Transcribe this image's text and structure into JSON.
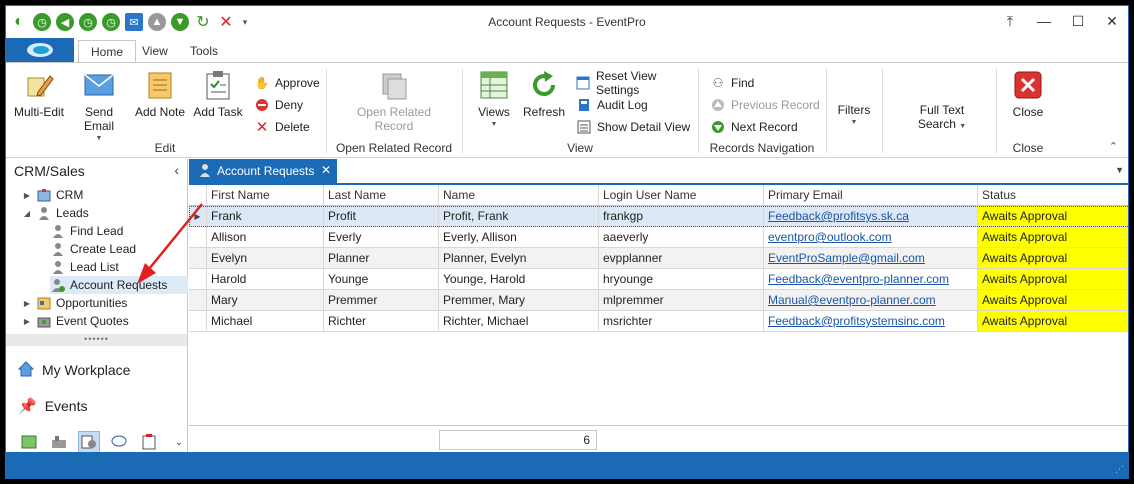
{
  "window": {
    "title": "Account Requests - EventPro"
  },
  "ribbon_tabs": [
    {
      "label": "Home",
      "active": true
    },
    {
      "label": "View",
      "active": false
    },
    {
      "label": "Tools",
      "active": false
    }
  ],
  "ribbon": {
    "edit_group": {
      "label": "Edit",
      "multi_edit": "Multi-Edit",
      "send_email": "Send Email",
      "add_note": "Add Note",
      "add_task": "Add Task",
      "approve": "Approve",
      "deny": "Deny",
      "delete": "Delete"
    },
    "open_related_group": {
      "label": "Open Related Record",
      "open_related_line1": "Open Related",
      "open_related_line2": "Record"
    },
    "view_group": {
      "label": "View",
      "views": "Views",
      "refresh": "Refresh",
      "reset_view": "Reset View Settings",
      "audit_log": "Audit Log",
      "show_detail": "Show Detail View"
    },
    "nav_group": {
      "label": "Records Navigation",
      "find": "Find",
      "previous": "Previous Record",
      "next": "Next Record"
    },
    "filters": "Filters",
    "fulltext": {
      "line1": "Full Text",
      "line2": "Search"
    },
    "close_group": {
      "label": "Close",
      "close": "Close"
    }
  },
  "navpane": {
    "header": "CRM/Sales",
    "tree": {
      "crm": "CRM",
      "leads": "Leads",
      "find_lead": "Find Lead",
      "create_lead": "Create Lead",
      "lead_list": "Lead List",
      "account_requests": "Account Requests",
      "opportunities": "Opportunities",
      "event_quotes": "Event Quotes"
    },
    "grip": "••••••",
    "my_workplace": "My Workplace",
    "events": "Events"
  },
  "doc_tab": {
    "label": "Account Requests"
  },
  "grid": {
    "columns": [
      "First Name",
      "Last Name",
      "Name",
      "Login User Name",
      "Primary Email",
      "Status"
    ],
    "rows": [
      {
        "first": "Frank",
        "last": "Profit",
        "name": "Profit, Frank",
        "login": "frankgp",
        "email": "Feedback@profitsys.sk.ca",
        "status": "Awaits Approval"
      },
      {
        "first": "Allison",
        "last": "Everly",
        "name": "Everly, Allison",
        "login": "aaeverly",
        "email": "eventpro@outlook.com",
        "status": "Awaits Approval"
      },
      {
        "first": "Evelyn",
        "last": "Planner",
        "name": "Planner, Evelyn",
        "login": "evpplanner",
        "email": "EventProSample@gmail.com",
        "status": "Awaits Approval"
      },
      {
        "first": "Harold",
        "last": "Younge",
        "name": "Younge, Harold",
        "login": "hryounge",
        "email": "Feedback@eventpro-planner.com",
        "status": "Awaits Approval"
      },
      {
        "first": "Mary",
        "last": "Premmer",
        "name": "Premmer, Mary",
        "login": "mlpremmer",
        "email": "Manual@eventpro-planner.com",
        "status": "Awaits Approval"
      },
      {
        "first": "Michael",
        "last": "Richter",
        "name": "Richter, Michael",
        "login": "msrichter",
        "email": "Feedback@profitsystemsinc.com",
        "status": "Awaits Approval"
      }
    ],
    "record_count": "6"
  },
  "colors": {
    "accent": "#1b6ab6",
    "status_highlight": "#ffff00",
    "arrow": "#e02020"
  }
}
